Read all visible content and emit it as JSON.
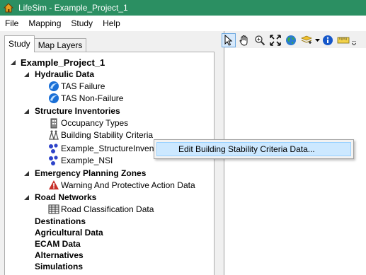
{
  "window": {
    "title": "LifeSim - Example_Project_1"
  },
  "menu": [
    "File",
    "Mapping",
    "Study",
    "Help"
  ],
  "tabs": [
    "Study",
    "Map Layers"
  ],
  "tree": {
    "root": "Example_Project_1",
    "hydraulic": {
      "label": "Hydraulic Data",
      "children": [
        "TAS Failure",
        "TAS Non-Failure"
      ]
    },
    "structure": {
      "label": "Structure Inventories",
      "children": [
        "Occupancy Types",
        "Building Stability Criteria",
        "Example_StructureInven",
        "Example_NSI"
      ]
    },
    "emergency": {
      "label": "Emergency Planning Zones",
      "children": [
        "Warning And Protective Action Data"
      ]
    },
    "road": {
      "label": "Road Networks",
      "children": [
        "Road Classification Data"
      ]
    },
    "others": [
      "Destinations",
      "Agricultural Data",
      "ECAM Data",
      "Alternatives",
      "Simulations"
    ]
  },
  "context_menu": {
    "item": "Edit Building Stability Criteria Data..."
  },
  "toolbar_icons": [
    "select-arrow-icon",
    "pan-hand-icon",
    "zoom-icon",
    "full-extent-icon",
    "globe-icon",
    "add-layer-icon",
    "dropdown-arrow-icon",
    "identify-info-icon",
    "measure-ruler-icon"
  ],
  "colors": {
    "titlebar": "#2b8f62",
    "selection": "#cce8ff"
  }
}
